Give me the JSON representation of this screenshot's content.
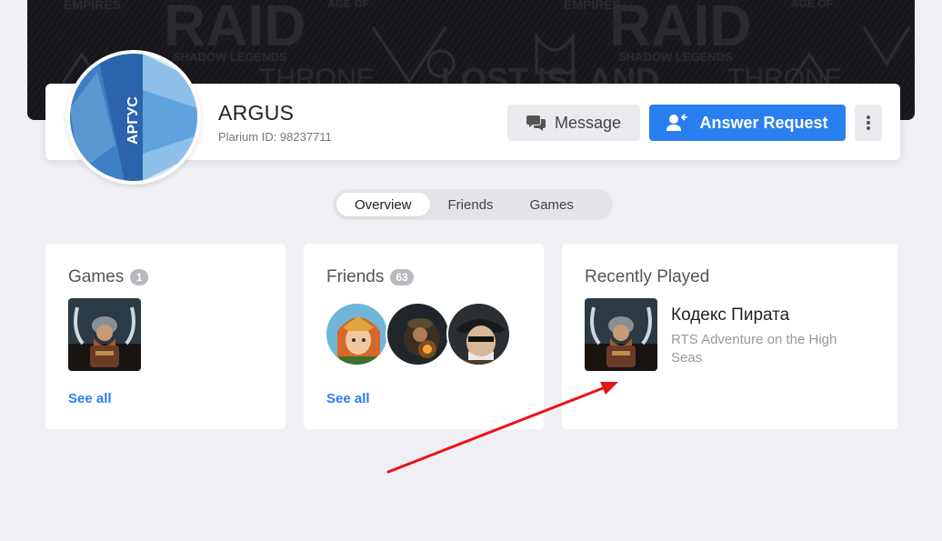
{
  "banner": {
    "background_texts": [
      "RAID",
      "SHADOW LEGENDS",
      "LOST ISLAND",
      "THRONE",
      "EMPIRES",
      "AGE OF"
    ]
  },
  "profile": {
    "avatar_text": "АРГУС",
    "username": "ARGUS",
    "plarium_id": "Plarium ID: 98237711",
    "message_label": "Message",
    "answer_label": "Answer Request"
  },
  "tabs": [
    {
      "label": "Overview",
      "active": true
    },
    {
      "label": "Friends",
      "active": false
    },
    {
      "label": "Games",
      "active": false
    }
  ],
  "games_card": {
    "title": "Games",
    "count": "1",
    "see_all": "See all"
  },
  "friends_card": {
    "title": "Friends",
    "count": "63",
    "see_all": "See all"
  },
  "recent_card": {
    "title": "Recently Played",
    "game_name": "Кодекс Пирата",
    "game_desc": "RTS Adventure on the High Seas"
  },
  "colors": {
    "accent": "#2a7ff0",
    "background": "#f0f0f4",
    "annotation_arrow": "#e8141a"
  },
  "icons": {
    "message": "chat-bubbles-icon",
    "answer": "user-reply-icon",
    "more": "vertical-dots-icon"
  }
}
